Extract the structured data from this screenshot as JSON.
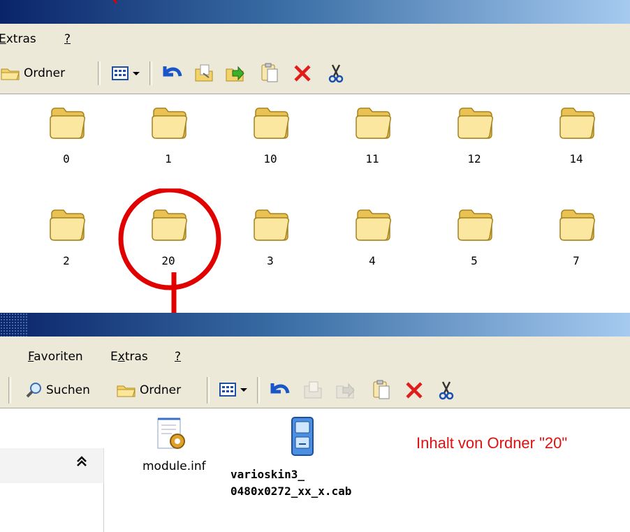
{
  "top_window": {
    "menu": {
      "extras": "xtras",
      "extras_access": "E",
      "help": "?"
    },
    "toolbar": {
      "folders_label": "Ordner"
    },
    "folders": [
      "0",
      "1",
      "10",
      "11",
      "12",
      "14",
      "2",
      "20",
      "3",
      "4",
      "5",
      "7"
    ],
    "highlighted_folder": "20"
  },
  "bottom_window": {
    "menu": {
      "favorites_access": "F",
      "favorites": "avoriten",
      "extras_pre": "E",
      "extras_access": "x",
      "extras_post": "tras",
      "help": "?"
    },
    "toolbar": {
      "search_label": "Suchen",
      "folders_label": "Ordner"
    },
    "files": [
      {
        "name": "module.inf",
        "icon": "settings-file-icon"
      },
      {
        "name_line1": "varioskin3_",
        "name_line2": "0480x0272_xx_x.cab",
        "icon": "cab-archive-icon"
      }
    ],
    "side_panel": {
      "collapse": "≈"
    }
  },
  "annotation": {
    "caption": "Inhalt von Ordner \"20\"",
    "color": "#e11010"
  },
  "colors": {
    "titlebar": "#0a246a",
    "chrome": "#ece9d8",
    "folder": "#f5dc72",
    "accent_red": "#e00000"
  }
}
